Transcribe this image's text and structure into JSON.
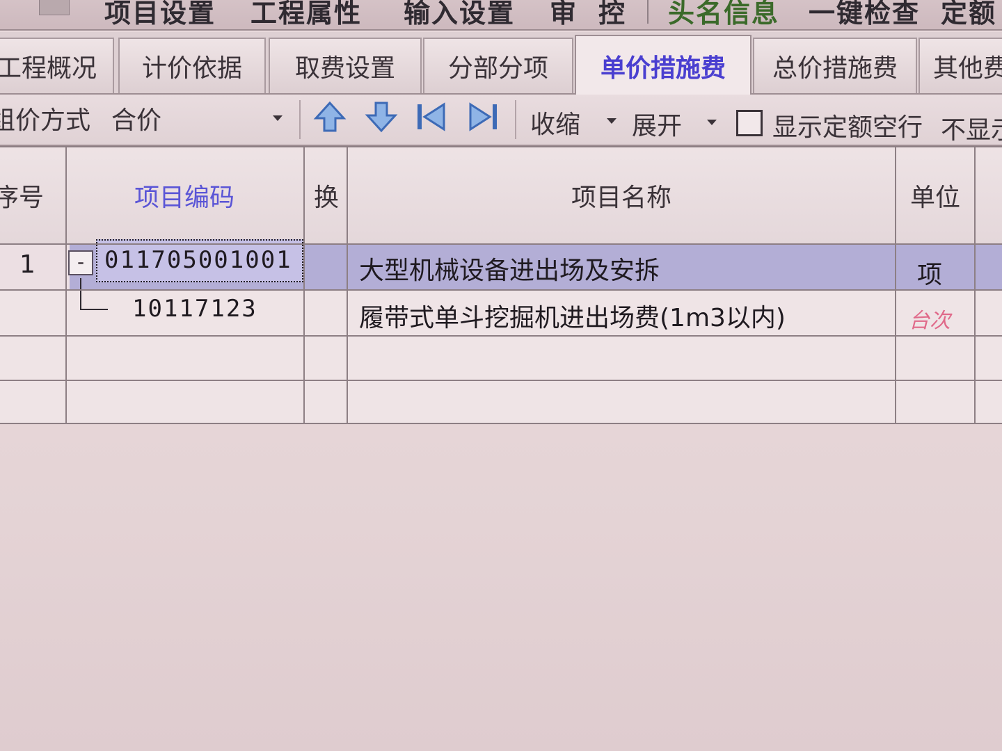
{
  "menu": {
    "items": [
      "项目设置",
      "工程属性",
      "输入设置",
      "审",
      "控",
      "头名信息",
      "一键检查",
      "定额"
    ]
  },
  "tabs": [
    {
      "label": "工程概况"
    },
    {
      "label": "计价依据"
    },
    {
      "label": "取费设置"
    },
    {
      "label": "分部分项"
    },
    {
      "label": "单价措施费",
      "active": true
    },
    {
      "label": "总价措施费"
    },
    {
      "label": "其他费"
    }
  ],
  "toolbar": {
    "combo_label": "组价方式",
    "combo_value": "合价",
    "collapse_label": "收缩",
    "expand_label": "展开",
    "show_empty_label": "显示定额空行",
    "hide_label": "不显示",
    "show_empty_checked": false
  },
  "grid": {
    "columns": {
      "seq": "序号",
      "code": "项目编码",
      "swap": "换",
      "name": "项目名称",
      "unit": "单位"
    },
    "rows": [
      {
        "seq": "1",
        "code": "011705001001",
        "name": "大型机械设备进出场及安拆",
        "unit": "项",
        "expanded": true
      },
      {
        "seq": "",
        "code": "10117123",
        "name": "履带式单斗挖掘机进出场费(1m3以内)",
        "unit": "台次"
      }
    ]
  },
  "colors": {
    "active_tab": "#4a3fd0",
    "selected_row": "#b3aed6",
    "header_blue": "#5a55d6",
    "unit_red": "#e06a8a"
  }
}
